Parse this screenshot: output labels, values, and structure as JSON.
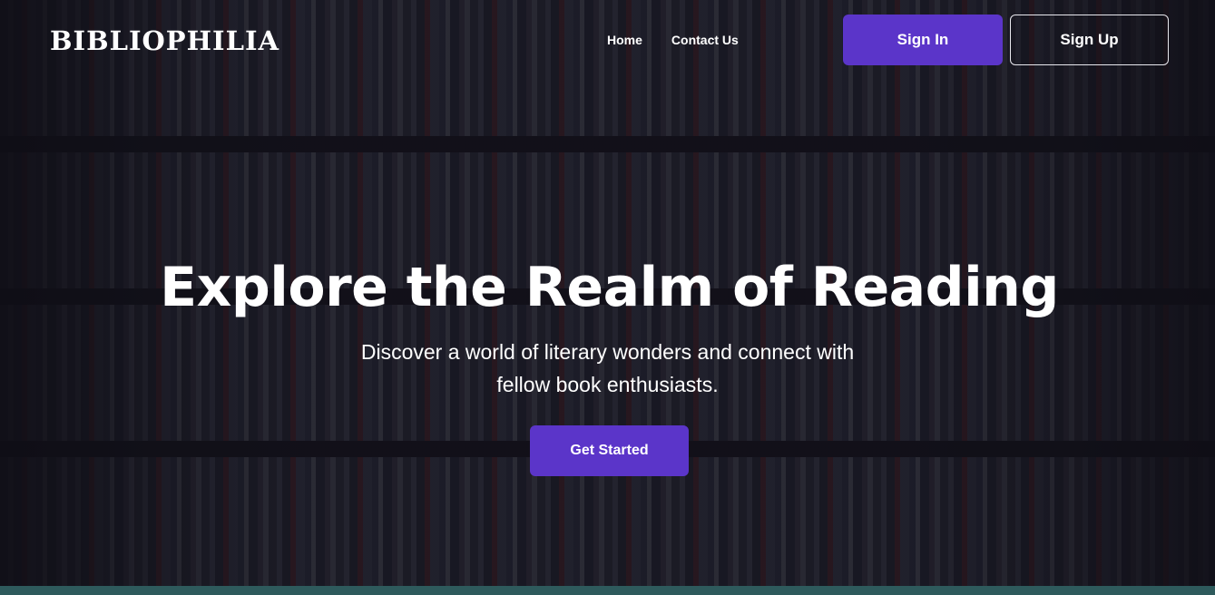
{
  "header": {
    "logo": "BIBLIOPHILIA",
    "nav": [
      {
        "label": "Home"
      },
      {
        "label": "Contact Us"
      }
    ],
    "sign_in_label": "Sign In",
    "sign_up_label": "Sign Up"
  },
  "hero": {
    "title": "Explore the Realm of Reading",
    "subtitle": "Discover a world of literary wonders and connect with fellow book enthusiasts.",
    "cta_label": "Get Started"
  },
  "colors": {
    "accent": "#5b35c9",
    "text": "#ffffff",
    "overlay": "#141219"
  }
}
